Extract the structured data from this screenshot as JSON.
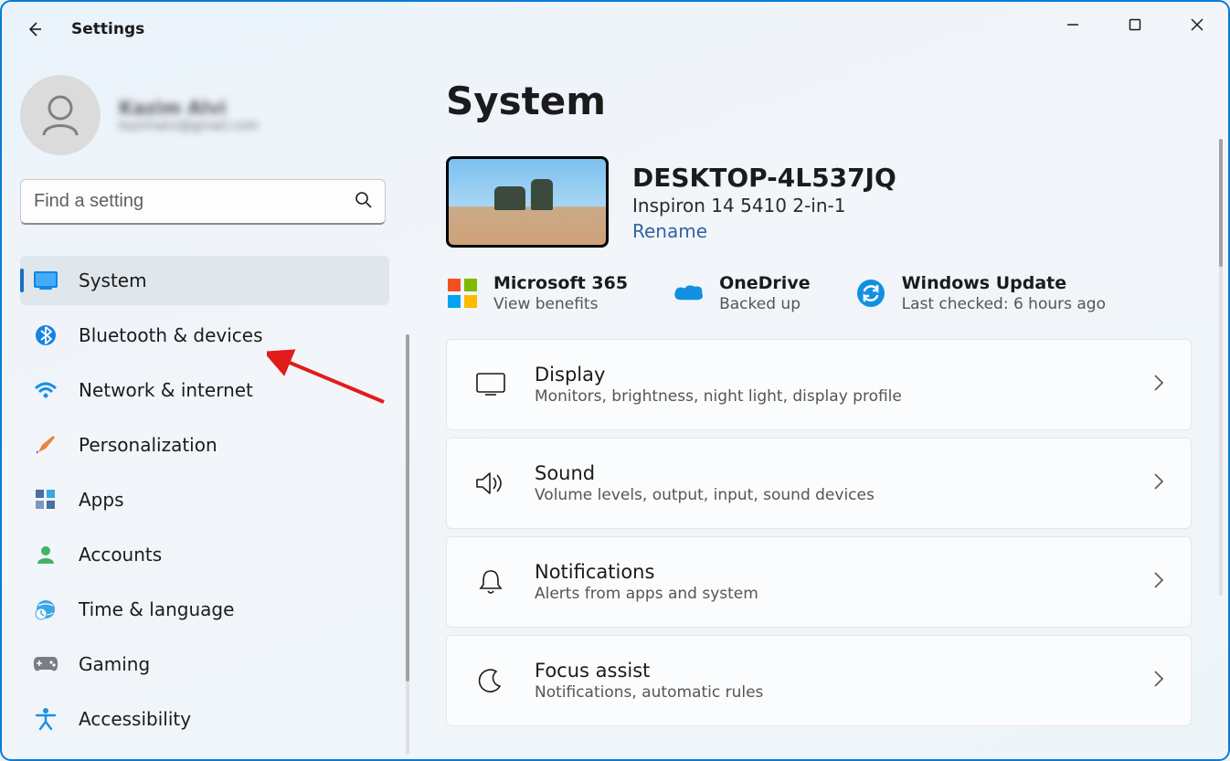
{
  "window": {
    "title": "Settings",
    "minimize": "−",
    "maximize": "▢",
    "close": "✕"
  },
  "account": {
    "name": "Kazim Alvi",
    "email": "kazimalvi@gmail.com"
  },
  "search": {
    "placeholder": "Find a setting"
  },
  "sidebar": {
    "items": [
      {
        "id": "system",
        "label": "System",
        "icon": "🖥️"
      },
      {
        "id": "bluetooth",
        "label": "Bluetooth & devices",
        "icon": "bt"
      },
      {
        "id": "network",
        "label": "Network & internet",
        "icon": "wifi"
      },
      {
        "id": "personalization",
        "label": "Personalization",
        "icon": "🖌️"
      },
      {
        "id": "apps",
        "label": "Apps",
        "icon": "apps"
      },
      {
        "id": "accounts",
        "label": "Accounts",
        "icon": "acct"
      },
      {
        "id": "time",
        "label": "Time & language",
        "icon": "🌐"
      },
      {
        "id": "gaming",
        "label": "Gaming",
        "icon": "🎮"
      },
      {
        "id": "accessibility",
        "label": "Accessibility",
        "icon": "acc"
      }
    ],
    "active": "system"
  },
  "page": {
    "heading": "System",
    "device": {
      "name": "DESKTOP-4L537JQ",
      "model": "Inspiron 14 5410 2-in-1",
      "rename": "Rename"
    },
    "status": {
      "m365": {
        "title": "Microsoft 365",
        "sub": "View benefits"
      },
      "onedrive": {
        "title": "OneDrive",
        "sub": "Backed up"
      },
      "wu": {
        "title": "Windows Update",
        "sub": "Last checked: 6 hours ago"
      }
    },
    "cards": [
      {
        "id": "display",
        "title": "Display",
        "sub": "Monitors, brightness, night light, display profile"
      },
      {
        "id": "sound",
        "title": "Sound",
        "sub": "Volume levels, output, input, sound devices"
      },
      {
        "id": "notifications",
        "title": "Notifications",
        "sub": "Alerts from apps and system"
      },
      {
        "id": "focus",
        "title": "Focus assist",
        "sub": "Notifications, automatic rules"
      }
    ]
  }
}
